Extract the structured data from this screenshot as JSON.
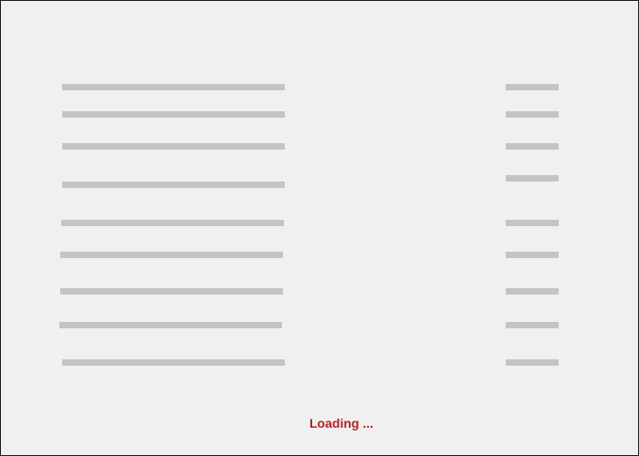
{
  "status": {
    "loading_text": "Loading ..."
  },
  "colors": {
    "background": "#f0f0f0",
    "skeleton": "#c4c4c4",
    "loading_text": "#b22222",
    "frame_border": "#1a1a1a"
  }
}
